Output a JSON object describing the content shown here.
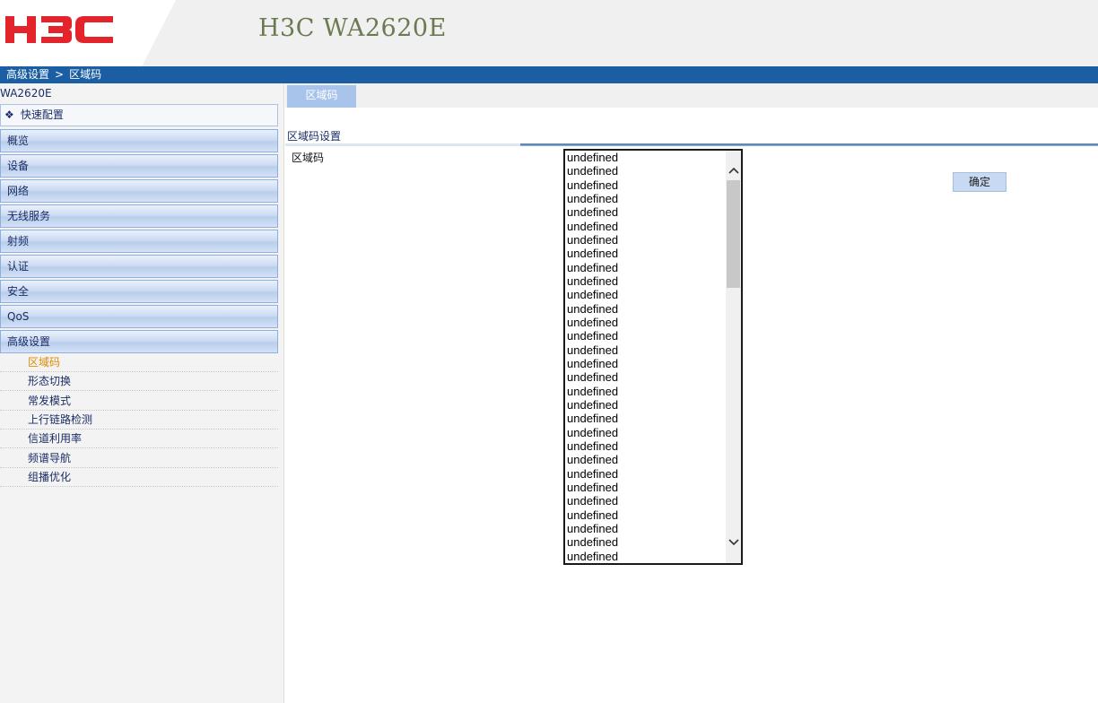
{
  "header": {
    "brand": "H3C",
    "product_title": "H3C WA2620E"
  },
  "breadcrumb": {
    "parent": "高级设置",
    "separator": ">",
    "current": "区域码"
  },
  "sidebar": {
    "device_name": "WA2620E",
    "quick_config": "快速配置",
    "menu": [
      {
        "label": "概览"
      },
      {
        "label": "设备"
      },
      {
        "label": "网络"
      },
      {
        "label": "无线服务"
      },
      {
        "label": "射频"
      },
      {
        "label": "认证"
      },
      {
        "label": "安全"
      },
      {
        "label": "QoS"
      },
      {
        "label": "高级设置"
      }
    ],
    "submenu": [
      {
        "label": "区域码",
        "active": true
      },
      {
        "label": "形态切换"
      },
      {
        "label": "常发模式"
      },
      {
        "label": "上行链路检测"
      },
      {
        "label": "信道利用率"
      },
      {
        "label": "频谱导航"
      },
      {
        "label": "组播优化"
      }
    ]
  },
  "main": {
    "tab_label": "区域码",
    "section_title": "区域码设置",
    "field_label": "区域码",
    "listbox_options": [
      "undefined",
      "undefined",
      "undefined",
      "undefined",
      "undefined",
      "undefined",
      "undefined",
      "undefined",
      "undefined",
      "undefined",
      "undefined",
      "undefined",
      "undefined",
      "undefined",
      "undefined",
      "undefined",
      "undefined",
      "undefined",
      "undefined",
      "undefined",
      "undefined",
      "undefined",
      "undefined",
      "undefined",
      "undefined",
      "undefined",
      "undefined",
      "undefined",
      "undefined",
      "undefined"
    ],
    "ok_button": "确定"
  },
  "colors": {
    "brand_red": "#e3242b",
    "breadcrumb_bar": "#1b5ea3",
    "tab_active": "#a8c4ea",
    "submenu_active": "#e08a00",
    "product_title": "#6b7a52"
  },
  "icons": {
    "quick_config": "diamond-icon",
    "scroll_up": "chevron-up-icon",
    "scroll_down": "chevron-down-icon"
  }
}
